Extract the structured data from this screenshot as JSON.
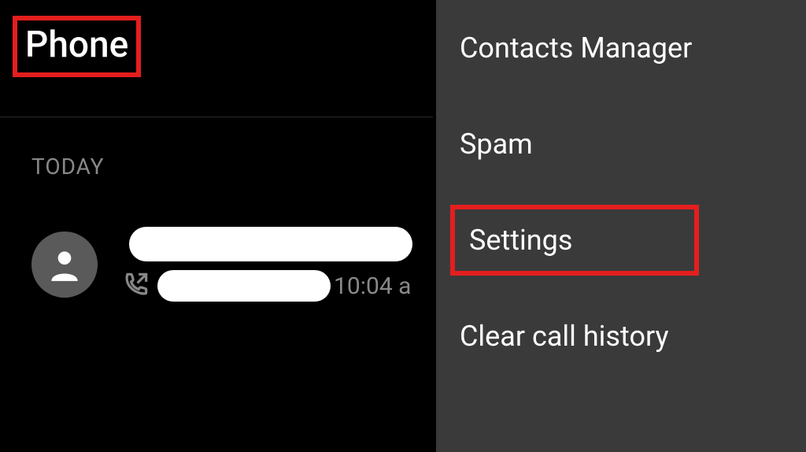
{
  "header": {
    "title": "Phone"
  },
  "section": {
    "label": "TODAY"
  },
  "call": {
    "time": "10:04 a"
  },
  "menu": {
    "items": [
      "Contacts Manager",
      "Spam",
      "Settings",
      "Clear call history"
    ]
  },
  "highlighted_index": 2
}
